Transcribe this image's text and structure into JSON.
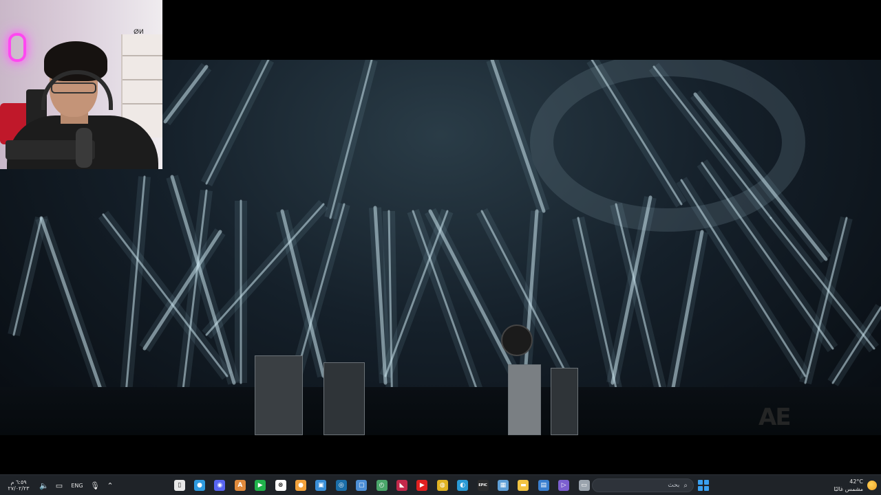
{
  "webcam": {
    "shelf_label": "ⵁⵍ"
  },
  "video": {
    "watermark": "AE"
  },
  "taskbar": {
    "clock": {
      "time": "٦:٥٩ م",
      "date": "٢٧/٠٢/٢٣"
    },
    "tray": [
      "speaker-icon",
      "network-icon"
    ],
    "language": "ENG",
    "apps": [
      {
        "name": "file-icon",
        "color": "#e8e8e8",
        "glyph": "▯"
      },
      {
        "name": "chat-app-icon",
        "color": "#2f9be0",
        "glyph": "●"
      },
      {
        "name": "discord-icon",
        "color": "#5865f2",
        "glyph": "◉"
      },
      {
        "name": "adobe-icon",
        "color": "#e08a3c",
        "glyph": "A"
      },
      {
        "name": "play-icon",
        "color": "#21b24b",
        "glyph": "▶"
      },
      {
        "name": "xbox-icon",
        "color": "#ffffff",
        "glyph": "⊗"
      },
      {
        "name": "game-app-icon",
        "color": "#f2a23c",
        "glyph": "●"
      },
      {
        "name": "window-icon",
        "color": "#3a8fd8",
        "glyph": "▣"
      },
      {
        "name": "steam-icon",
        "color": "#1b6ea8",
        "glyph": "◎"
      },
      {
        "name": "app-window-icon",
        "color": "#4d8fd6",
        "glyph": "▢"
      },
      {
        "name": "clock-app-icon",
        "color": "#4aa66a",
        "glyph": "◴"
      },
      {
        "name": "red-app-icon",
        "color": "#c3284a",
        "glyph": "◣"
      },
      {
        "name": "youtube-icon",
        "color": "#e02020",
        "glyph": "▶"
      },
      {
        "name": "chrome-icon",
        "color": "#e0b323",
        "glyph": "◍"
      },
      {
        "name": "edge-icon",
        "color": "#2a9ad6",
        "glyph": "◐"
      },
      {
        "name": "epic-games-icon",
        "color": "#2b2b2b",
        "glyph": "EPIC"
      },
      {
        "name": "photos-icon",
        "color": "#5fa0d8",
        "glyph": "▦"
      },
      {
        "name": "folder-icon",
        "color": "#f2c443",
        "glyph": "▬"
      },
      {
        "name": "store-icon",
        "color": "#3a7fd0",
        "glyph": "▤"
      },
      {
        "name": "media-player-icon",
        "color": "#7c5fd0",
        "glyph": "▷"
      },
      {
        "name": "task-view-icon",
        "color": "#9aa3ad",
        "glyph": "▭"
      }
    ],
    "search": {
      "placeholder": "بحث"
    },
    "weather": {
      "temperature": "42°C",
      "condition": "مشمس غالبًا"
    }
  }
}
